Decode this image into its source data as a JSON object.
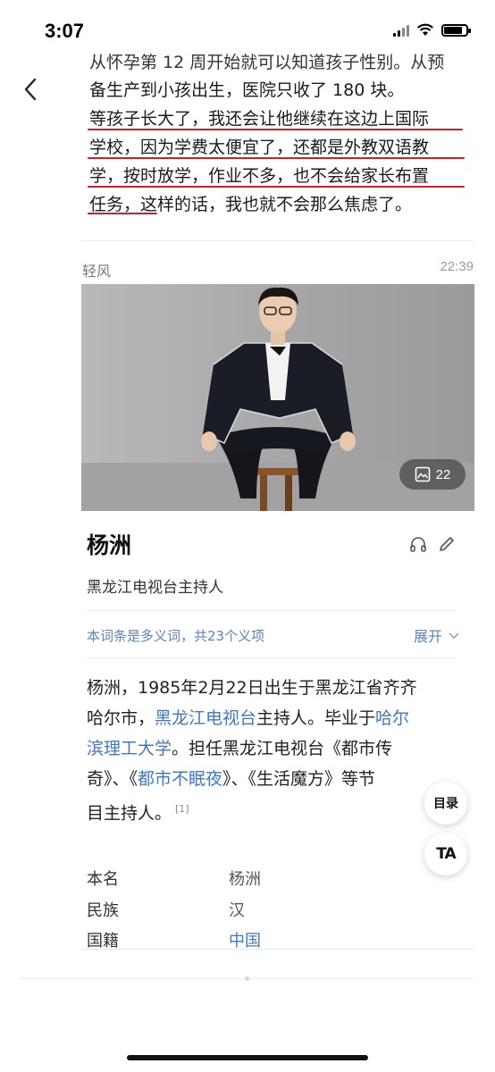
{
  "status_bar": {
    "time": "3:07",
    "icons": [
      "cellular-signal-icon",
      "wifi-icon",
      "battery-icon"
    ],
    "battery_level": 0.85
  },
  "top_bar": {
    "back_icon": "chevron-left-icon",
    "more_icon": "more-dots-icon"
  },
  "message": {
    "lines": [
      "从怀孕第 12 周开始就可以知道孩子性别。从预",
      "备生产到小孩出生，医院只收了 180 块。",
      "等孩子长大了，我还会让他继续在这边上国际",
      "学校，因为学费太便宜了，还都是外教双语教",
      "学，按时放学，作业不多，也不会给家长布置",
      "任务，这样的话，我也就不会那么焦虑了。"
    ],
    "underline_color": "#cc2030"
  },
  "meta": {
    "sender": "轻风",
    "time": "22:39"
  },
  "baike": {
    "photo_count": "22",
    "name": "杨洲",
    "subtitle": "黑龙江电视台主持人",
    "polysemy_note": "本词条是多义词，共23个义项",
    "expand_label": "展开",
    "intro": {
      "l1": "杨洲，1985年2月22日出生于黑龙江省齐齐",
      "l2_a": "哈尔市，",
      "l2_link": "黑龙江电视台",
      "l2_b": "主持人。毕业于",
      "l2_link2": "哈尔",
      "l3_link": "滨理工大学",
      "l3_b": "。担任黑龙江电视台《都市传",
      "l4_a": "奇》、《",
      "l4_link": "都市不眠夜",
      "l4_b": "》、《生活魔方》等节",
      "l5": "目主持人。",
      "ref": "[1]"
    },
    "info": [
      {
        "key": "本名",
        "value": "杨洲"
      },
      {
        "key": "民族",
        "value": "汉"
      },
      {
        "key": "国籍",
        "value": "中国"
      }
    ],
    "link_color": "#3f78c3"
  },
  "floating": {
    "toc_label": "目录",
    "ta_label": "TA"
  }
}
